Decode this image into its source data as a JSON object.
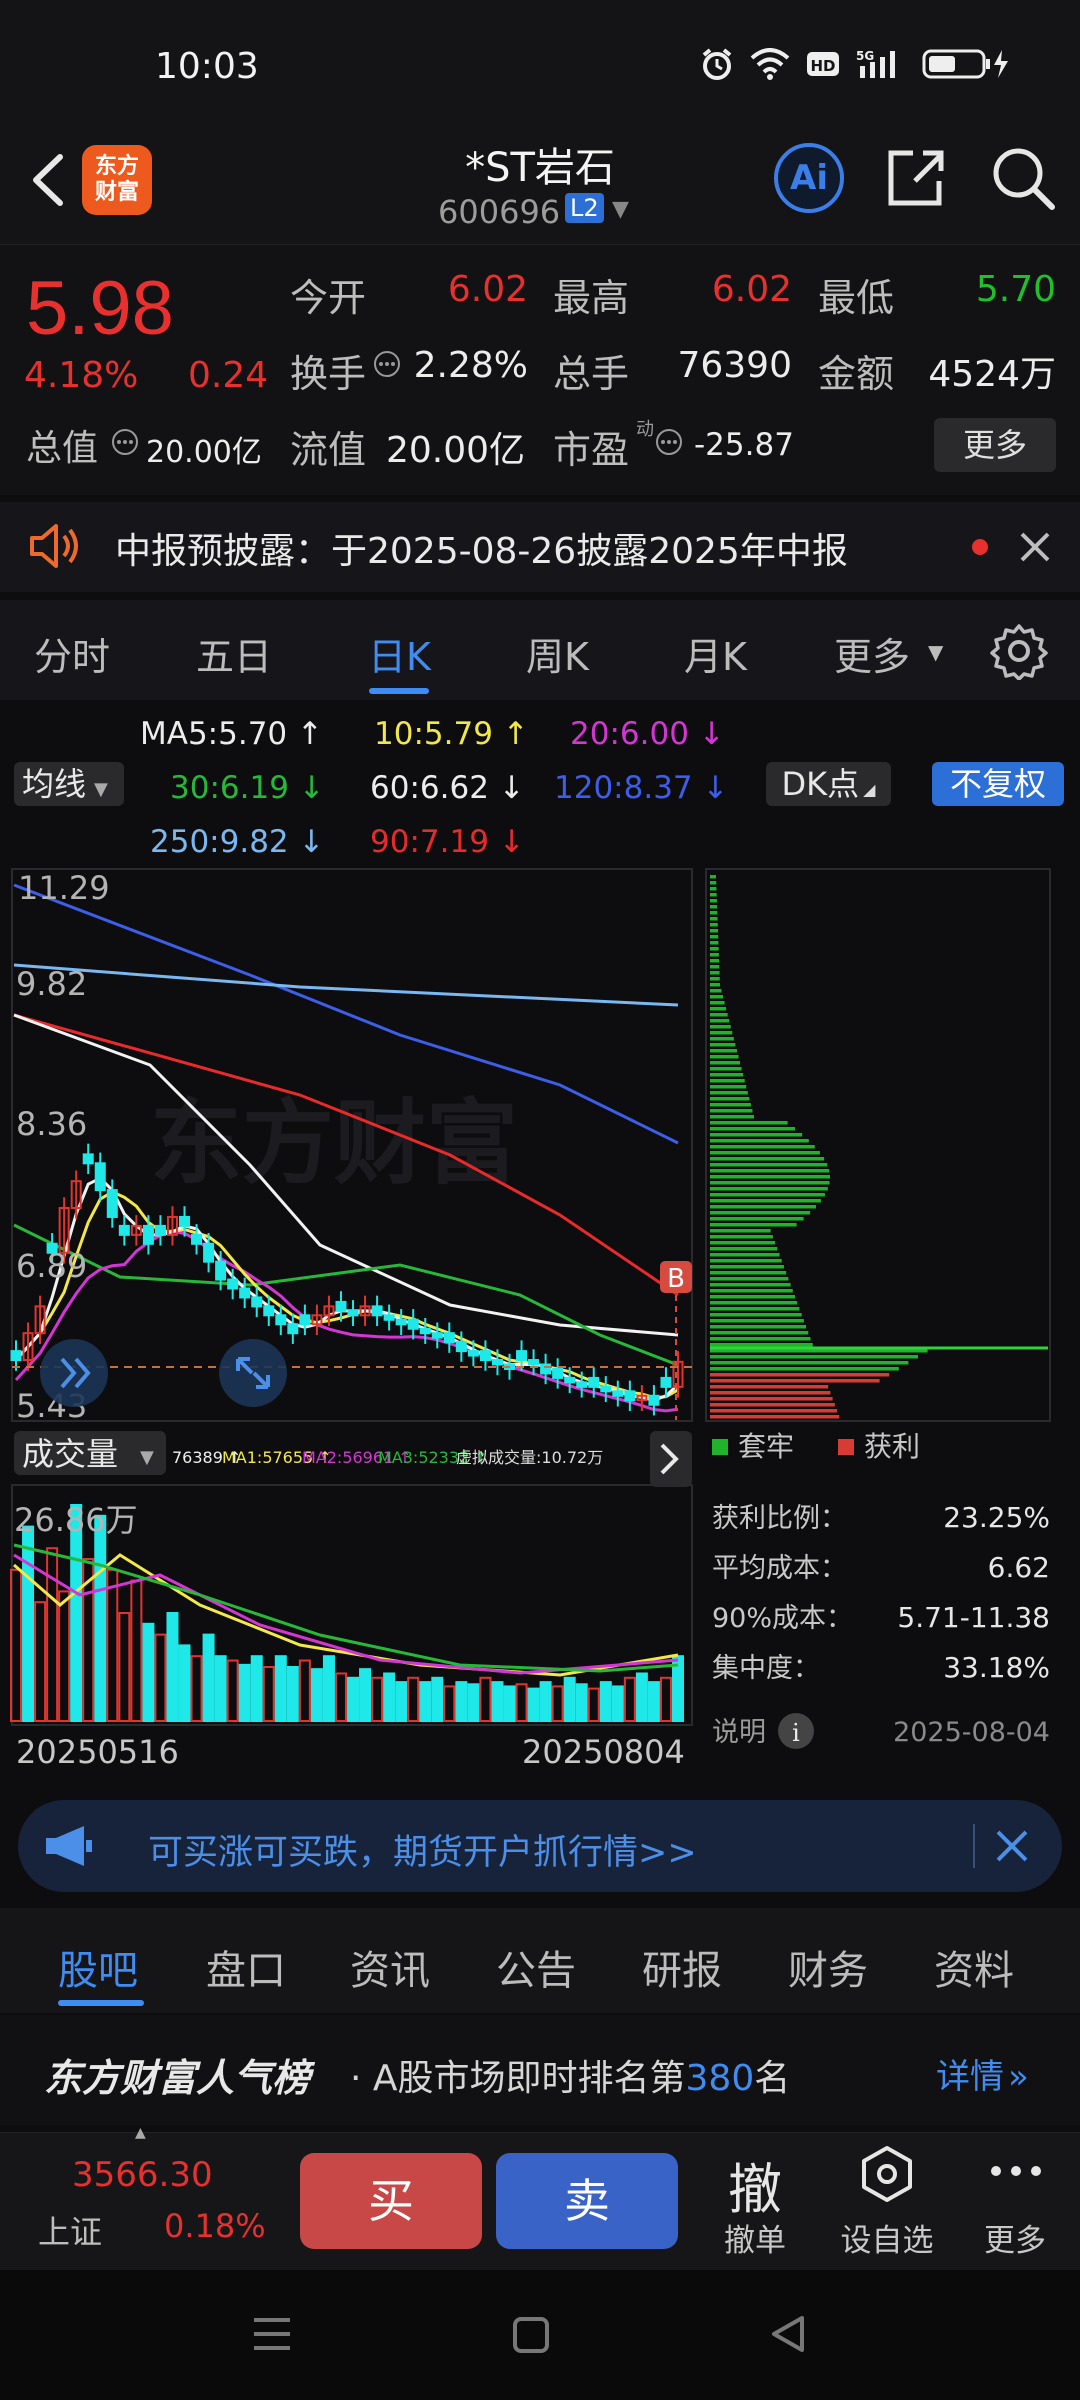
{
  "status": {
    "time": "10:03"
  },
  "header": {
    "logo_line1": "东方",
    "logo_line2": "财富",
    "name": "*ST岩石",
    "code": "600696",
    "level": "L2",
    "ai": "Ai"
  },
  "quote": {
    "price": "5.98",
    "pct": "4.18%",
    "change": "0.24",
    "open_label": "今开",
    "open": "6.02",
    "high_label": "最高",
    "high": "6.02",
    "low_label": "最低",
    "low": "5.70",
    "turnover_label": "换手",
    "turnover": "2.28%",
    "volume_label": "总手",
    "volume": "76390",
    "amount_label": "金额",
    "amount": "4524万",
    "mktcap_label": "总值",
    "mktcap": "20.00亿",
    "float_label": "流值",
    "float": "20.00亿",
    "pe_label": "市盈",
    "pe_sup": "动",
    "pe": "-25.87",
    "more": "更多"
  },
  "notice": {
    "text": "中报预披露：于2025-08-26披露2025年中报"
  },
  "period_tabs": [
    "分时",
    "五日",
    "日K",
    "周K",
    "月K",
    "更多"
  ],
  "ma": {
    "select": "均线",
    "ma5": "MA5:5.70 ↑",
    "ma10": "10:5.79 ↑",
    "ma20": "20:6.00 ↓",
    "ma30": "30:6.19 ↓",
    "ma60": "60:6.62 ↓",
    "ma120": "120:8.37 ↓",
    "ma250": "250:9.82 ↓",
    "ma90": "90:7.19 ↓",
    "dk": "DK点",
    "adjust": "不复权"
  },
  "chart": {
    "price_ticks": [
      "11.29",
      "9.82",
      "8.36",
      "6.89",
      "5.43"
    ],
    "signal": "B",
    "volume_select": "成交量",
    "vol_legend": [
      "76389 ↑",
      "MA1:57655 ↑",
      "MA2:56961 ↑",
      "MA3:52332 ↑",
      "虚拟成交量:10.72万"
    ],
    "vol_max": "26.86万",
    "date_start": "20250516",
    "date_end": "20250804",
    "watermark": "东方财富",
    "colors": {
      "up": "#e0352f",
      "down": "#1ee8e8",
      "ma5": "#f2f2f2",
      "ma10": "#f2e84a",
      "ma20": "#d436d4",
      "ma30": "#27b83a",
      "ma60": "#f2f2f2",
      "ma90": "#e82a2a",
      "ma120": "#3c5ee8",
      "ma250": "#7ab8f2"
    }
  },
  "chips": {
    "legend_trapped": "套牢",
    "legend_profit": "获利",
    "profit_ratio_label": "获利比例：",
    "profit_ratio": "23.25%",
    "avg_cost_label": "平均成本：",
    "avg_cost": "6.62",
    "cost90_label": "90%成本：",
    "cost90": "5.71-11.38",
    "concentration_label": "集中度：",
    "concentration": "33.18%",
    "explain": "说明",
    "date": "2025-08-04"
  },
  "promo": {
    "text": "可买涨可买跌，期货开户抓行情>>"
  },
  "content_tabs": [
    "股吧",
    "盘口",
    "资讯",
    "公告",
    "研报",
    "财务",
    "资料"
  ],
  "rank": {
    "brand": "东方财富人气榜",
    "text_pre": "· A股市场即时排名第",
    "rank": "380",
    "text_post": "名",
    "detail": "详情"
  },
  "bottom": {
    "index_value": "3566.30",
    "index_name": "上证",
    "index_pct": "0.18%",
    "buy": "买",
    "sell": "卖",
    "cancel_glyph": "撤",
    "cancel": "撤单",
    "watch": "设自选",
    "more": "更多"
  }
}
